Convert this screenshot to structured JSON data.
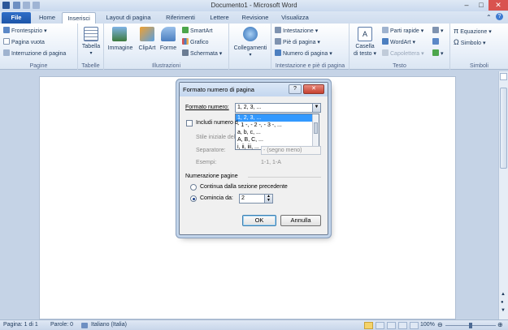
{
  "window": {
    "title": "Documento1 - Microsoft Word",
    "minimize": "–",
    "maximize": "□",
    "close": "✕"
  },
  "tabs": {
    "file": "File",
    "items": [
      "Home",
      "Inserisci",
      "Layout di pagina",
      "Riferimenti",
      "Lettere",
      "Revisione",
      "Visualizza"
    ],
    "active": "Inserisci"
  },
  "ribbon": {
    "pagine": {
      "label": "Pagine",
      "frontespizio": "Frontespizio ▾",
      "pagina_vuota": "Pagina vuota",
      "interruzione": "Interruzione di pagina"
    },
    "tabelle": {
      "label": "Tabelle",
      "tabella": "Tabella"
    },
    "illustrazioni": {
      "label": "Illustrazioni",
      "immagine": "Immagine",
      "clipart": "ClipArt",
      "forme": "Forme",
      "smartart": "SmartArt",
      "grafico": "Grafico",
      "schermata": "Schermata ▾"
    },
    "collegamenti": {
      "label": "",
      "collegamenti": "Collegamenti"
    },
    "intestazione": {
      "label": "Intestazione e piè di pagina",
      "intestazione": "Intestazione ▾",
      "pie": "Piè di pagina ▾",
      "numero": "Numero di pagina ▾"
    },
    "testo": {
      "label": "Testo",
      "casella": "Casella",
      "casella2": "di testo ▾",
      "parti_rapide": "Parti rapide ▾",
      "wordart": "WordArt ▾",
      "capolettera": "Capolettera ▾"
    },
    "simboli": {
      "label": "Simboli",
      "equazione": "Equazione ▾",
      "simbolo": "Simbolo ▾"
    }
  },
  "dialog": {
    "title": "Formato numero di pagina",
    "help": "?",
    "close": "✕",
    "formato_label": "Formato numero:",
    "formato_value": "1, 2, 3, ...",
    "options": [
      "1, 2, 3, ...",
      "- 1 -, - 2 -, - 3 -, ...",
      "a, b, c, ...",
      "A, B, C, ...",
      "i, ii, iii, ..."
    ],
    "includi_label": "Includi numero d",
    "stile_label": "Stile iniziale del",
    "separatore_label": "Separatore:",
    "separatore_value": "-   (segno meno)",
    "esempi_label": "Esempi:",
    "esempi_value": "1-1, 1-A",
    "numerazione_label": "Numerazione pagine",
    "continua_label": "Continua dalla sezione precedente",
    "comincia_label": "Comincia da:",
    "comincia_value": "2",
    "ok": "OK",
    "annulla": "Annulla"
  },
  "status": {
    "pagina": "Pagina: 1 di 1",
    "parole": "Parole: 0",
    "lingua": "Italiano (Italia)",
    "zoom": "100%"
  },
  "colors": {
    "accent": "#2f6ec8",
    "selection": "#3399ff"
  }
}
